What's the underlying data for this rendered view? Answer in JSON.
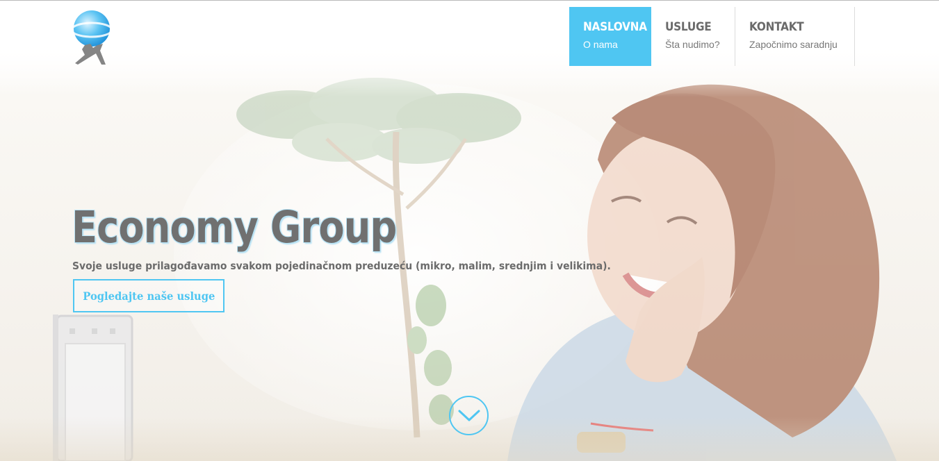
{
  "nav": {
    "items": [
      {
        "title": "NASLOVNA",
        "subtitle": "O nama",
        "active": true
      },
      {
        "title": "USLUGE",
        "subtitle": "Šta nudimo?",
        "active": false
      },
      {
        "title": "KONTAKT",
        "subtitle": "Započnimo saradnju",
        "active": false
      }
    ]
  },
  "hero": {
    "title": "Economy Group",
    "subtitle": "Svoje usluge prilagođavamo svakom pojedinačnom preduzeću (mikro, malim, srednjim i velikima).",
    "cta_label": "Pogledajte naše usluge"
  },
  "icons": {
    "logo": "globe-atlas-logo",
    "scroll": "chevron-down-icon"
  },
  "colors": {
    "accent": "#4fc6f2",
    "heading_text": "#707070",
    "nav_text": "#6a6a6a"
  }
}
